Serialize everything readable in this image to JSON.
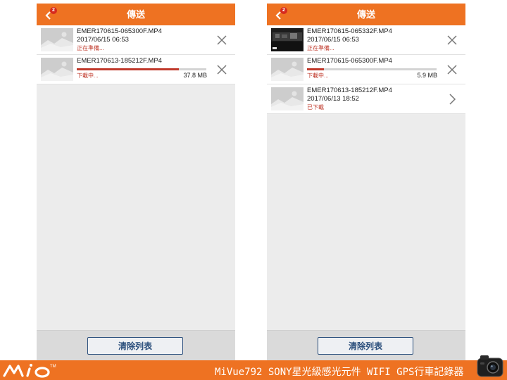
{
  "header": {
    "title": "傳送",
    "badge_count": "2"
  },
  "colors": {
    "accent": "#ee7222",
    "status_red": "#c0392b",
    "button_border": "#2b4f7c"
  },
  "left_phone": {
    "items": [
      {
        "filename": "EMER170615-065300F.MP4",
        "date": "2017/06/15    06:53",
        "status": "正在準備...",
        "thumb": "placeholder-image",
        "action": "close-icon"
      },
      {
        "filename": "EMER170613-185212F.MP4",
        "status": "下載中...",
        "progress": 0.79,
        "size": "37.8 MB",
        "thumb": "placeholder-image",
        "action": "close-icon"
      }
    ],
    "clear_button": "清除列表"
  },
  "right_phone": {
    "items": [
      {
        "filename": "EMER170615-065332F.MP4",
        "date": "2017/06/15    06:53",
        "status": "正在準備...",
        "thumb": "video-frame-thumbnail",
        "action": "close-icon"
      },
      {
        "filename": "EMER170615-065300F.MP4",
        "status": "下載中...",
        "progress": 0.13,
        "size": "5.9 MB",
        "thumb": "placeholder-image",
        "action": "close-icon"
      },
      {
        "filename": "EMER170613-185212F.MP4",
        "date": "2017/06/13    18:52",
        "status": "已下載",
        "thumb": "placeholder-image",
        "action": "chevron-right-icon"
      }
    ],
    "clear_button": "清除列表"
  },
  "footer_banner": {
    "brand": "mio",
    "product_text": "MiVue792 SONY星光級感光元件 WIFI GPS行車記錄器"
  }
}
